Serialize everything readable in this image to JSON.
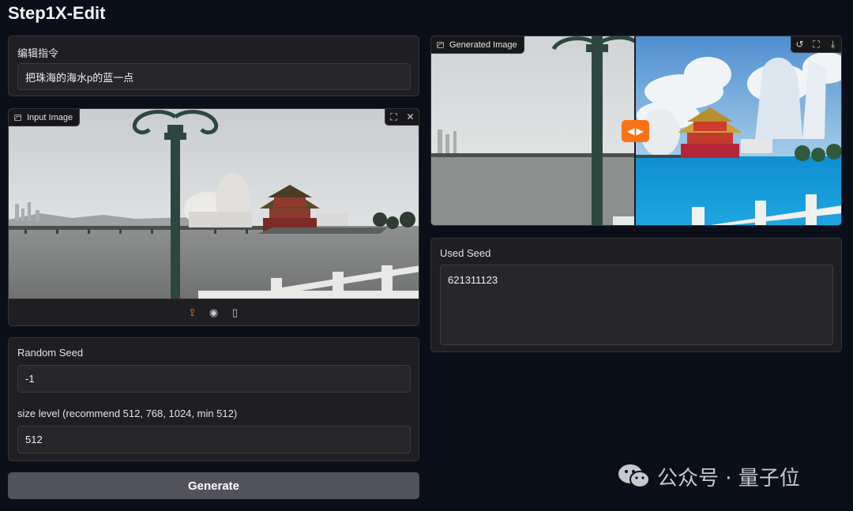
{
  "app": {
    "title": "Step1X-Edit"
  },
  "instruction": {
    "label": "编辑指令",
    "value": "把珠海的海水p的蓝一点"
  },
  "input_image": {
    "label": "Input Image",
    "tools": [
      "fullscreen-icon",
      "close-icon"
    ],
    "sources": [
      "upload-icon",
      "webcam-icon",
      "clipboard-icon"
    ]
  },
  "settings": {
    "seed_label": "Random Seed",
    "seed_value": "-1",
    "size_label": "size level (recommend 512, 768, 1024, min 512)",
    "size_value": "512"
  },
  "generate": {
    "label": "Generate"
  },
  "output_image": {
    "label": "Generated Image",
    "tools": [
      "undo-icon",
      "fullscreen-icon",
      "download-icon"
    ],
    "slider_handle": "compare-slider"
  },
  "used_seed": {
    "label": "Used Seed",
    "value": "621311123"
  },
  "watermark": {
    "text": "公众号 · 量子位"
  },
  "colors": {
    "background": "#0b0f19",
    "panel": "#1f1f23",
    "accent": "#f97316",
    "button": "#52525b"
  }
}
